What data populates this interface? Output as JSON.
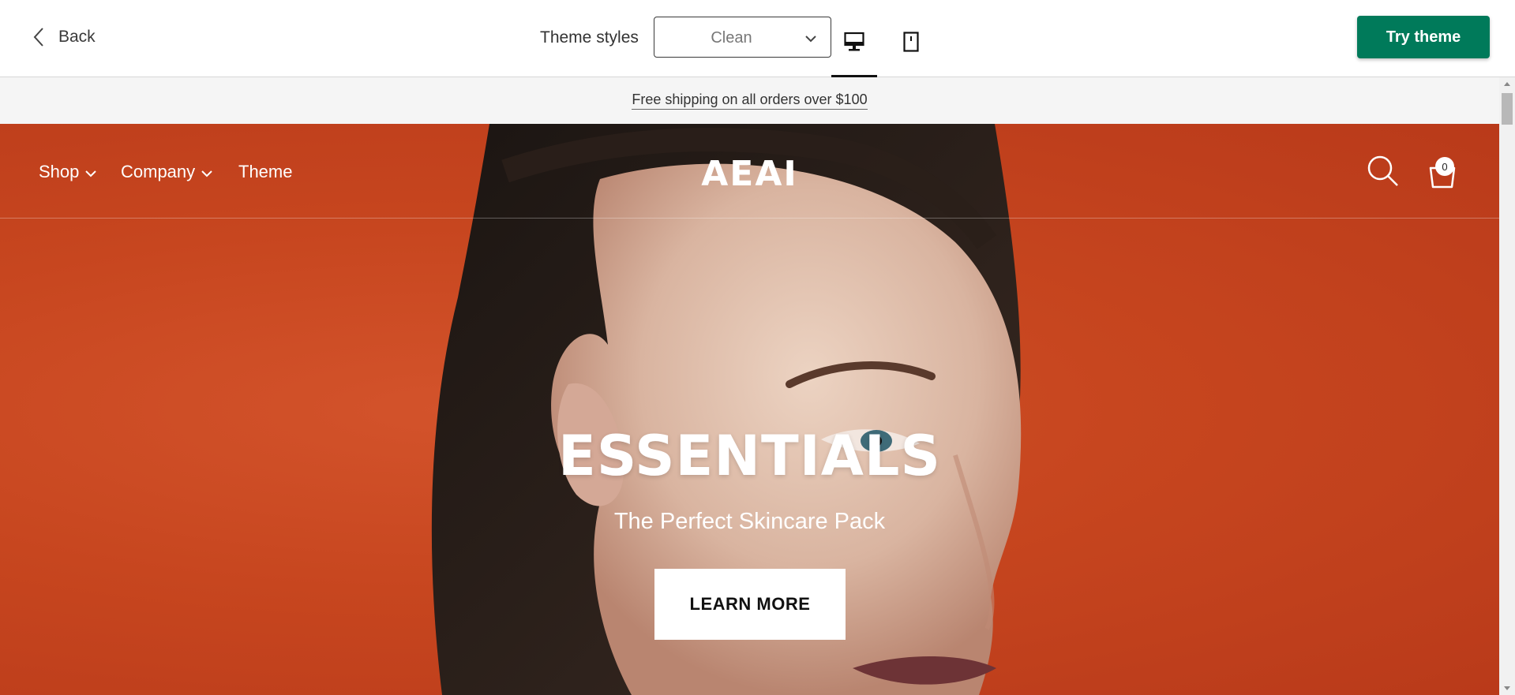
{
  "toolbar": {
    "back_label": "Back",
    "theme_styles_label": "Theme styles",
    "theme_style_value": "Clean",
    "try_theme_label": "Try theme",
    "accent_color": "#007a5a",
    "devices": [
      "desktop-icon",
      "tablet-icon"
    ],
    "active_device": "desktop"
  },
  "store": {
    "announcement": "Free shipping on all orders over $100",
    "nav": {
      "items": [
        {
          "label": "Shop",
          "has_dropdown": true
        },
        {
          "label": "Company",
          "has_dropdown": true
        },
        {
          "label": "Theme",
          "has_dropdown": false
        }
      ],
      "logo": "AEAI",
      "cart_count": "0"
    },
    "hero": {
      "title": "ESSENTIALS",
      "subtitle": "The Perfect Skincare Pack",
      "button_label": "LEARN MORE",
      "background_color": "#c7461f"
    }
  }
}
